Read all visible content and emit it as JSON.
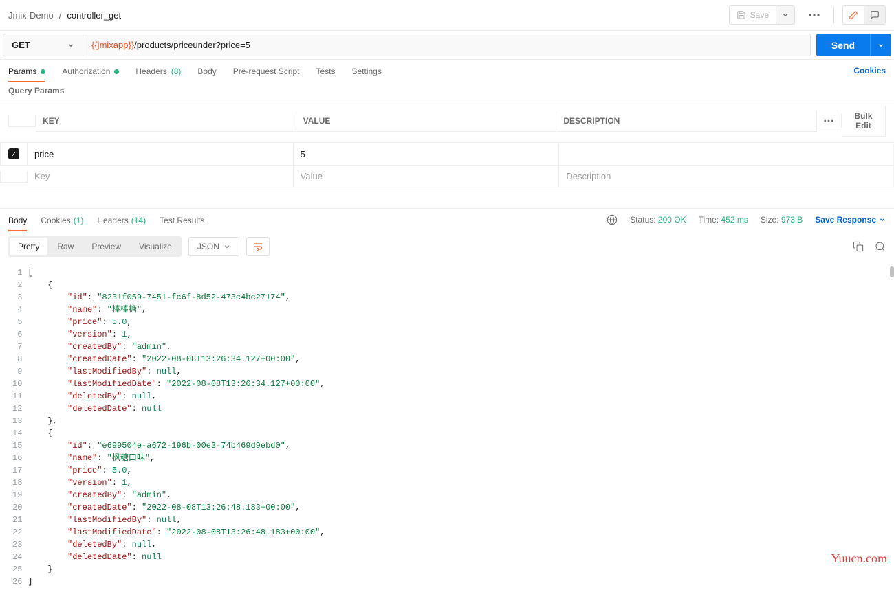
{
  "breadcrumb": {
    "root": "Jmix-Demo",
    "sep": "/",
    "current": "controller_get"
  },
  "header": {
    "save": "Save"
  },
  "request": {
    "method": "GET",
    "url_var": "{{jmixapp}}",
    "url_path": "/products/priceunder?price=5",
    "send": "Send"
  },
  "req_tabs": {
    "params": "Params",
    "auth": "Authorization",
    "headers": "Headers",
    "headers_count": "(8)",
    "body": "Body",
    "prescript": "Pre-request Script",
    "tests": "Tests",
    "settings": "Settings",
    "cookies": "Cookies"
  },
  "query_params": {
    "title": "Query Params",
    "cols": {
      "key": "KEY",
      "value": "VALUE",
      "desc": "DESCRIPTION",
      "bulk": "Bulk Edit"
    },
    "rows": [
      {
        "checked": true,
        "key": "price",
        "value": "5",
        "desc": ""
      }
    ],
    "placeholders": {
      "key": "Key",
      "value": "Value",
      "desc": "Description"
    }
  },
  "resp_tabs": {
    "body": "Body",
    "cookies": "Cookies",
    "cookies_count": "(1)",
    "headers": "Headers",
    "headers_count": "(14)",
    "tests": "Test Results"
  },
  "resp_meta": {
    "status_l": "Status:",
    "status_v": "200 OK",
    "time_l": "Time:",
    "time_v": "452 ms",
    "size_l": "Size:",
    "size_v": "973 B",
    "save": "Save Response"
  },
  "format": {
    "pretty": "Pretty",
    "raw": "Raw",
    "preview": "Preview",
    "visualize": "Visualize",
    "lang": "JSON"
  },
  "code": {
    "lines": [
      {
        "n": 1,
        "t": [
          {
            "c": "p",
            "v": "["
          }
        ]
      },
      {
        "n": 2,
        "t": [
          {
            "c": "p",
            "v": "    {"
          }
        ]
      },
      {
        "n": 3,
        "t": [
          {
            "c": "p",
            "v": "        "
          },
          {
            "c": "k",
            "v": "\"id\""
          },
          {
            "c": "p",
            "v": ": "
          },
          {
            "c": "s",
            "v": "\"8231f059-7451-fc6f-8d52-473c4bc27174\""
          },
          {
            "c": "p",
            "v": ","
          }
        ]
      },
      {
        "n": 4,
        "t": [
          {
            "c": "p",
            "v": "        "
          },
          {
            "c": "k",
            "v": "\"name\""
          },
          {
            "c": "p",
            "v": ": "
          },
          {
            "c": "s",
            "v": "\"棒棒糖\""
          },
          {
            "c": "p",
            "v": ","
          }
        ]
      },
      {
        "n": 5,
        "t": [
          {
            "c": "p",
            "v": "        "
          },
          {
            "c": "k",
            "v": "\"price\""
          },
          {
            "c": "p",
            "v": ": "
          },
          {
            "c": "n",
            "v": "5.0"
          },
          {
            "c": "p",
            "v": ","
          }
        ]
      },
      {
        "n": 6,
        "t": [
          {
            "c": "p",
            "v": "        "
          },
          {
            "c": "k",
            "v": "\"version\""
          },
          {
            "c": "p",
            "v": ": "
          },
          {
            "c": "n",
            "v": "1"
          },
          {
            "c": "p",
            "v": ","
          }
        ]
      },
      {
        "n": 7,
        "t": [
          {
            "c": "p",
            "v": "        "
          },
          {
            "c": "k",
            "v": "\"createdBy\""
          },
          {
            "c": "p",
            "v": ": "
          },
          {
            "c": "s",
            "v": "\"admin\""
          },
          {
            "c": "p",
            "v": ","
          }
        ]
      },
      {
        "n": 8,
        "t": [
          {
            "c": "p",
            "v": "        "
          },
          {
            "c": "k",
            "v": "\"createdDate\""
          },
          {
            "c": "p",
            "v": ": "
          },
          {
            "c": "s",
            "v": "\"2022-08-08T13:26:34.127+00:00\""
          },
          {
            "c": "p",
            "v": ","
          }
        ]
      },
      {
        "n": 9,
        "t": [
          {
            "c": "p",
            "v": "        "
          },
          {
            "c": "k",
            "v": "\"lastModifiedBy\""
          },
          {
            "c": "p",
            "v": ": "
          },
          {
            "c": "nl",
            "v": "null"
          },
          {
            "c": "p",
            "v": ","
          }
        ]
      },
      {
        "n": 10,
        "t": [
          {
            "c": "p",
            "v": "        "
          },
          {
            "c": "k",
            "v": "\"lastModifiedDate\""
          },
          {
            "c": "p",
            "v": ": "
          },
          {
            "c": "s",
            "v": "\"2022-08-08T13:26:34.127+00:00\""
          },
          {
            "c": "p",
            "v": ","
          }
        ]
      },
      {
        "n": 11,
        "t": [
          {
            "c": "p",
            "v": "        "
          },
          {
            "c": "k",
            "v": "\"deletedBy\""
          },
          {
            "c": "p",
            "v": ": "
          },
          {
            "c": "nl",
            "v": "null"
          },
          {
            "c": "p",
            "v": ","
          }
        ]
      },
      {
        "n": 12,
        "t": [
          {
            "c": "p",
            "v": "        "
          },
          {
            "c": "k",
            "v": "\"deletedDate\""
          },
          {
            "c": "p",
            "v": ": "
          },
          {
            "c": "nl",
            "v": "null"
          }
        ]
      },
      {
        "n": 13,
        "t": [
          {
            "c": "p",
            "v": "    },"
          }
        ]
      },
      {
        "n": 14,
        "t": [
          {
            "c": "p",
            "v": "    {"
          }
        ]
      },
      {
        "n": 15,
        "t": [
          {
            "c": "p",
            "v": "        "
          },
          {
            "c": "k",
            "v": "\"id\""
          },
          {
            "c": "p",
            "v": ": "
          },
          {
            "c": "s",
            "v": "\"e699504e-a672-196b-00e3-74b469d9ebd0\""
          },
          {
            "c": "p",
            "v": ","
          }
        ]
      },
      {
        "n": 16,
        "t": [
          {
            "c": "p",
            "v": "        "
          },
          {
            "c": "k",
            "v": "\"name\""
          },
          {
            "c": "p",
            "v": ": "
          },
          {
            "c": "s",
            "v": "\"枫糖口味\""
          },
          {
            "c": "p",
            "v": ","
          }
        ]
      },
      {
        "n": 17,
        "t": [
          {
            "c": "p",
            "v": "        "
          },
          {
            "c": "k",
            "v": "\"price\""
          },
          {
            "c": "p",
            "v": ": "
          },
          {
            "c": "n",
            "v": "5.0"
          },
          {
            "c": "p",
            "v": ","
          }
        ]
      },
      {
        "n": 18,
        "t": [
          {
            "c": "p",
            "v": "        "
          },
          {
            "c": "k",
            "v": "\"version\""
          },
          {
            "c": "p",
            "v": ": "
          },
          {
            "c": "n",
            "v": "1"
          },
          {
            "c": "p",
            "v": ","
          }
        ]
      },
      {
        "n": 19,
        "t": [
          {
            "c": "p",
            "v": "        "
          },
          {
            "c": "k",
            "v": "\"createdBy\""
          },
          {
            "c": "p",
            "v": ": "
          },
          {
            "c": "s",
            "v": "\"admin\""
          },
          {
            "c": "p",
            "v": ","
          }
        ]
      },
      {
        "n": 20,
        "t": [
          {
            "c": "p",
            "v": "        "
          },
          {
            "c": "k",
            "v": "\"createdDate\""
          },
          {
            "c": "p",
            "v": ": "
          },
          {
            "c": "s",
            "v": "\"2022-08-08T13:26:48.183+00:00\""
          },
          {
            "c": "p",
            "v": ","
          }
        ]
      },
      {
        "n": 21,
        "t": [
          {
            "c": "p",
            "v": "        "
          },
          {
            "c": "k",
            "v": "\"lastModifiedBy\""
          },
          {
            "c": "p",
            "v": ": "
          },
          {
            "c": "nl",
            "v": "null"
          },
          {
            "c": "p",
            "v": ","
          }
        ]
      },
      {
        "n": 22,
        "t": [
          {
            "c": "p",
            "v": "        "
          },
          {
            "c": "k",
            "v": "\"lastModifiedDate\""
          },
          {
            "c": "p",
            "v": ": "
          },
          {
            "c": "s",
            "v": "\"2022-08-08T13:26:48.183+00:00\""
          },
          {
            "c": "p",
            "v": ","
          }
        ]
      },
      {
        "n": 23,
        "t": [
          {
            "c": "p",
            "v": "        "
          },
          {
            "c": "k",
            "v": "\"deletedBy\""
          },
          {
            "c": "p",
            "v": ": "
          },
          {
            "c": "nl",
            "v": "null"
          },
          {
            "c": "p",
            "v": ","
          }
        ]
      },
      {
        "n": 24,
        "t": [
          {
            "c": "p",
            "v": "        "
          },
          {
            "c": "k",
            "v": "\"deletedDate\""
          },
          {
            "c": "p",
            "v": ": "
          },
          {
            "c": "nl",
            "v": "null"
          }
        ]
      },
      {
        "n": 25,
        "t": [
          {
            "c": "p",
            "v": "    }"
          }
        ]
      },
      {
        "n": 26,
        "t": [
          {
            "c": "p",
            "v": "]"
          }
        ]
      }
    ]
  },
  "watermark": "Yuucn.com"
}
